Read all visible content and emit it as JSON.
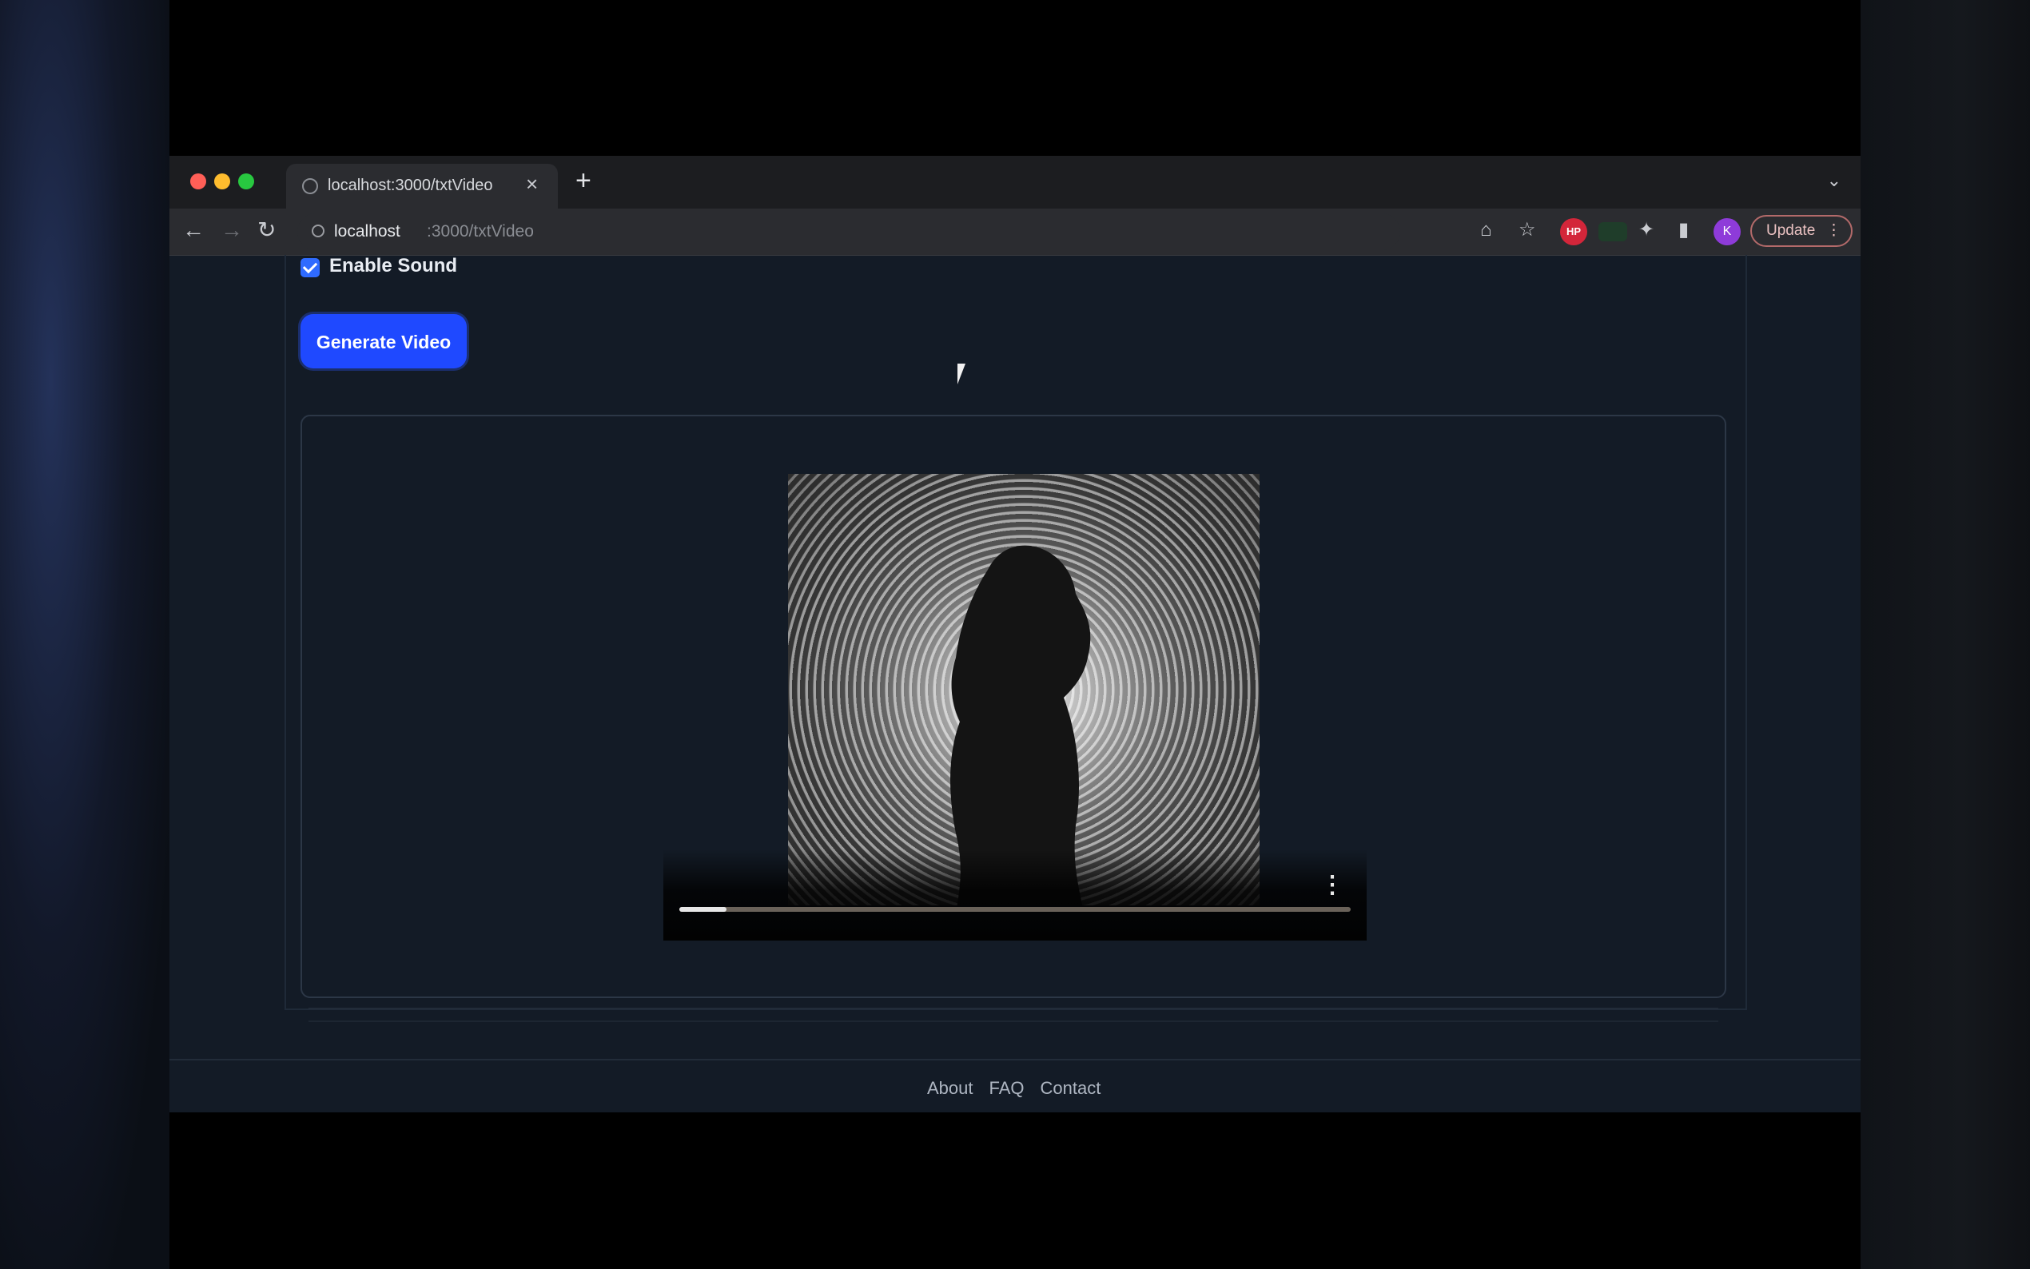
{
  "browser": {
    "tab_title": "localhost:3000/txtVideo",
    "url_host": "localhost",
    "url_path": ":3000/txtVideo",
    "profile_initial": "K",
    "extension_badge": "HP",
    "update_label": "Update",
    "icons": {
      "close": "×",
      "new_tab": "+",
      "back": "←",
      "forward": "→",
      "reload": "↻",
      "chevron": "⌄",
      "cast": "⌂",
      "star": "☆",
      "puzzle": "✦",
      "sidepanel": "▮",
      "menu": "⋮"
    }
  },
  "form": {
    "enable_sound_label": "Enable Sound",
    "enable_sound_checked": true,
    "generate_button_label": "Generate Video"
  },
  "video": {
    "progress": 0.07,
    "more_icon": "⋮"
  },
  "footer": {
    "links": [
      "About",
      "FAQ",
      "Contact"
    ]
  },
  "colors": {
    "accent": "#1f49ff",
    "page_bg": "#131b26"
  }
}
